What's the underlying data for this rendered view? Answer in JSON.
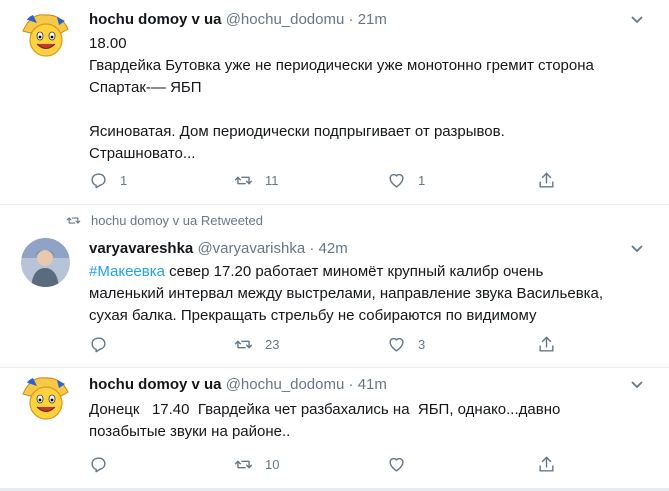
{
  "tweets": [
    {
      "name": "hochu domoy v ua",
      "handle": "@hochu_dodomu",
      "dot": "·",
      "time": "21m",
      "lines": [
        "18.00",
        "Гвардейка Бутовка уже не периодически уже монотонно гремит сторона",
        "Спартак-— ЯБП",
        "",
        "Ясиноватая. Дом периодически подпрыгивает от разрывов.",
        "Страшновато..."
      ],
      "replies": "1",
      "retweets": "11",
      "likes": "1"
    },
    {
      "retweet_label": "hochu domoy v ua Retweeted",
      "name": "varyavareshka",
      "handle": "@varyavarishka",
      "dot": "·",
      "time": "42m",
      "hashtag": "#Макеевка",
      "line1_rest": " север 17.20 работает миномёт крупный калибр очень",
      "line2": "маленький интервал между выстрелами, направление звука Васильевка,",
      "line3": "сухая балка. Прекращать стрельбу не собираются по видимому",
      "replies": "",
      "retweets": "23",
      "likes": "3"
    },
    {
      "name": "hochu domoy v ua",
      "handle": "@hochu_dodomu",
      "dot": "·",
      "time": "41m",
      "line1": "Донецк   17.40  Гвардейка чет разбахались на  ЯБП, однако...давно",
      "line2": "позабытые звуки на районе..",
      "replies": "",
      "retweets": "10",
      "likes": ""
    }
  ],
  "colors": {
    "accent": "#1da1f2",
    "muted": "#657786",
    "border": "#e6ecf0"
  },
  "icons": [
    "emoji-avatar",
    "person-avatar",
    "reply-icon",
    "retweet-icon",
    "like-icon",
    "share-icon",
    "chevron-down-icon"
  ]
}
